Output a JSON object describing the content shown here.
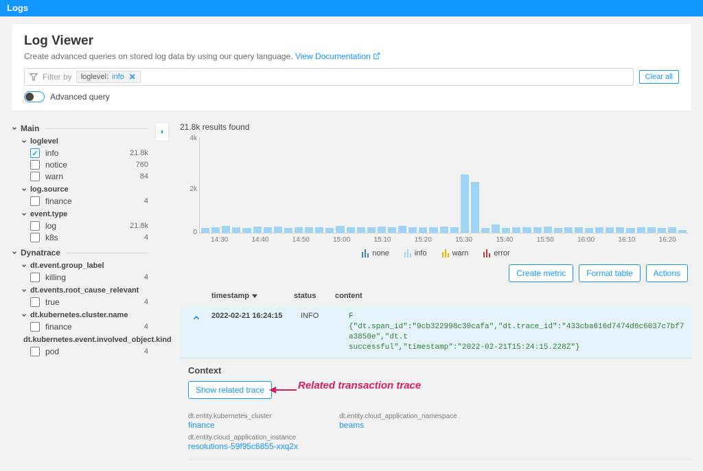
{
  "topbar": {
    "title": "Logs"
  },
  "header": {
    "title": "Log Viewer",
    "subtitle": "Create advanced queries on stored log data by using our query language.",
    "doc_link": "View Documentation"
  },
  "filter": {
    "placeholder": "Filter by",
    "chip_key": "loglevel:",
    "chip_value": "info",
    "clear_all": "Clear all",
    "advanced_label": "Advanced query"
  },
  "sidebar": {
    "sections": [
      {
        "title": "Main",
        "groups": [
          {
            "title": "loglevel",
            "items": [
              {
                "label": "info",
                "count": "21.8k",
                "checked": true
              },
              {
                "label": "notice",
                "count": "760",
                "checked": false
              },
              {
                "label": "warn",
                "count": "84",
                "checked": false
              }
            ]
          },
          {
            "title": "log.source",
            "items": [
              {
                "label": "finance",
                "count": "4",
                "checked": false
              }
            ]
          },
          {
            "title": "event.type",
            "items": [
              {
                "label": "log",
                "count": "21.8k",
                "checked": false
              },
              {
                "label": "k8s",
                "count": "4",
                "checked": false
              }
            ]
          }
        ]
      },
      {
        "title": "Dynatrace",
        "groups": [
          {
            "title": "dt.event.group_label",
            "items": [
              {
                "label": "killing",
                "count": "4",
                "checked": false
              }
            ]
          },
          {
            "title": "dt.events.root_cause_relevant",
            "items": [
              {
                "label": "true",
                "count": "4",
                "checked": false
              }
            ]
          },
          {
            "title": "dt.kubernetes.cluster.name",
            "items": [
              {
                "label": "finance",
                "count": "4",
                "checked": false
              }
            ]
          },
          {
            "title": "dt.kubernetes.event.involved_object.kind",
            "items": [
              {
                "label": "pod",
                "count": "4",
                "checked": false
              }
            ]
          }
        ]
      }
    ]
  },
  "results": {
    "count_label": "21.8k results found",
    "legend": {
      "none": "none",
      "info": "info",
      "warn": "warn",
      "error": "error"
    },
    "actions": {
      "create_metric": "Create metric",
      "format_table": "Format table",
      "actions": "Actions"
    },
    "columns": {
      "timestamp": "timestamp",
      "status": "status",
      "content": "content"
    },
    "row": {
      "timestamp": "2022-02-21 16:24:15",
      "status": "INFO",
      "content_line1": "F",
      "content_line2": "{\"dt.span_id\":\"9cb322998c30cafa\",\"dt.trace_id\":\"433cba616d7474d6c6037c7bf7a3850e\",\"dt.t",
      "content_line3": "successful\",\"timestamp\":\"2022-02-21T15:24:15.228Z\"}"
    }
  },
  "context": {
    "heading": "Context",
    "show_trace": "Show related trace",
    "annotation": "Related transaction trace",
    "col1": [
      {
        "k": "dt.entity.kubernetes_cluster",
        "v": "finance"
      },
      {
        "k": "dt.entity.cloud_application_instance",
        "v": "resolutions-59f95c6855-xxq2x"
      }
    ],
    "col2": [
      {
        "k": "dt.entity.cloud_application_namespace",
        "v": "beams"
      }
    ]
  },
  "chart_data": {
    "type": "bar",
    "title": "",
    "xlabel": "",
    "ylabel": "",
    "ylim": [
      0,
      4000
    ],
    "yticks": [
      "0",
      "2k",
      "4k"
    ],
    "xticks": [
      "14:30",
      "14:40",
      "14:50",
      "15:00",
      "15:10",
      "15:20",
      "15:30",
      "15:40",
      "15:50",
      "16:00",
      "16:10",
      "16:20"
    ],
    "values": [
      250,
      290,
      370,
      290,
      260,
      330,
      290,
      310,
      260,
      280,
      300,
      290,
      270,
      350,
      290,
      300,
      280,
      310,
      290,
      370,
      300,
      280,
      300,
      320,
      290,
      3100,
      2700,
      260,
      450,
      260,
      300,
      300,
      290,
      310,
      270,
      290,
      280,
      270,
      300,
      290,
      280,
      260,
      290,
      300,
      260,
      280,
      150
    ]
  },
  "colors": {
    "accent": "#1496ff",
    "bar": "#9ed5f6",
    "annotation": "#d81e5b"
  }
}
